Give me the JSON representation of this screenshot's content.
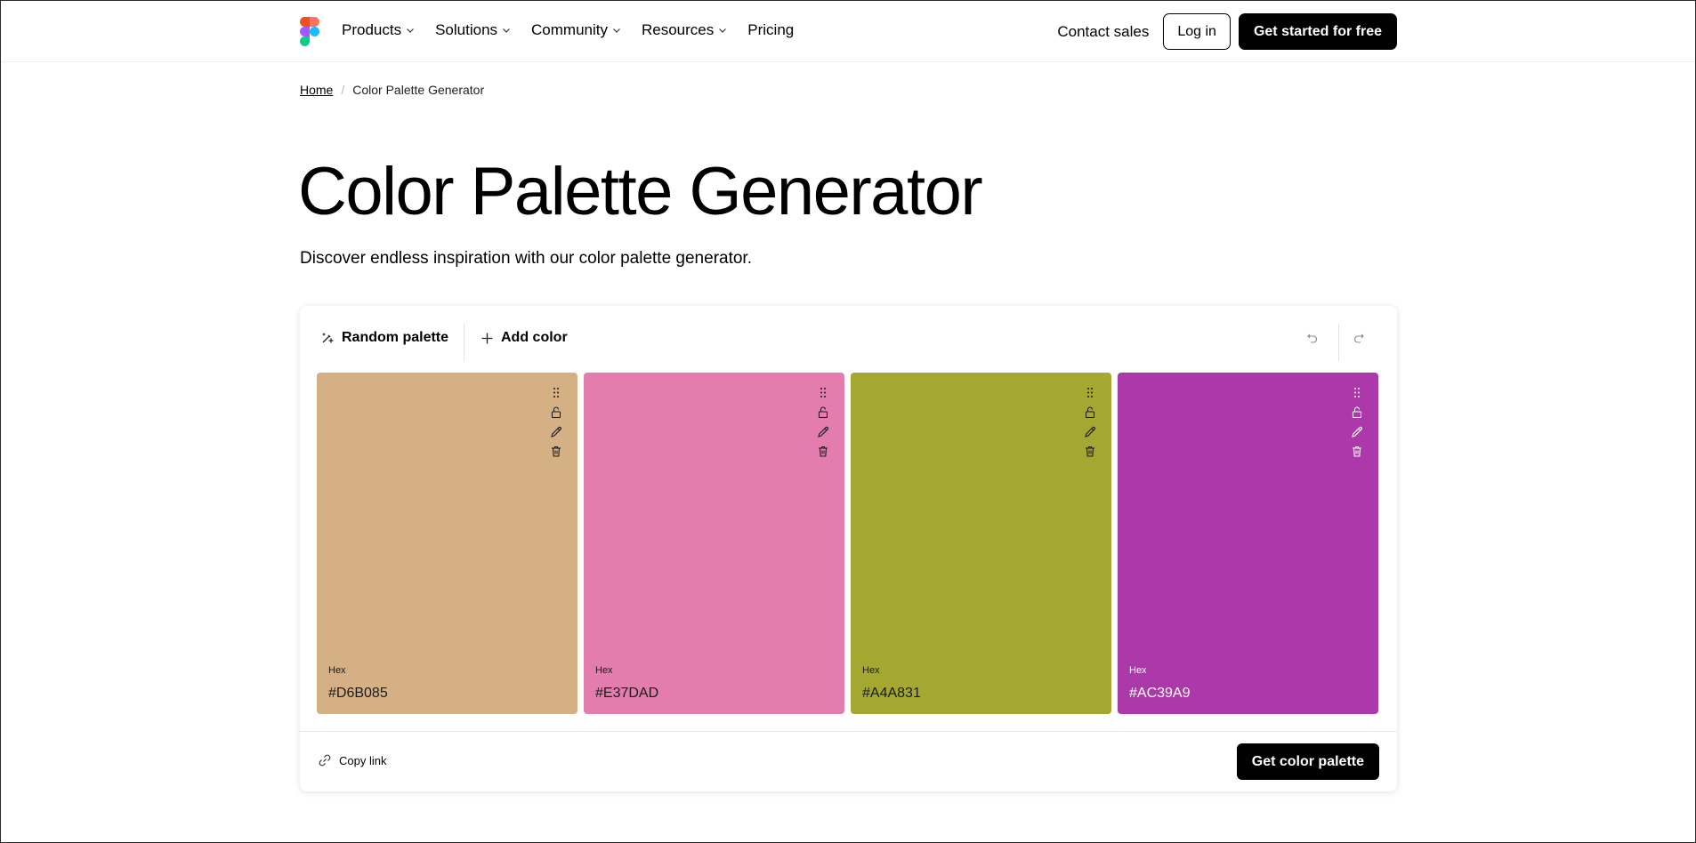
{
  "nav": {
    "items": [
      {
        "label": "Products",
        "has_dropdown": true
      },
      {
        "label": "Solutions",
        "has_dropdown": true
      },
      {
        "label": "Community",
        "has_dropdown": true
      },
      {
        "label": "Resources",
        "has_dropdown": true
      },
      {
        "label": "Pricing",
        "has_dropdown": false
      }
    ],
    "contact_label": "Contact sales",
    "login_label": "Log in",
    "start_label": "Get started for free",
    "logo_icon": "figma-logo-icon"
  },
  "breadcrumb": {
    "home": "Home",
    "current": "Color Palette Generator"
  },
  "hero": {
    "title": "Color Palette Generator",
    "subtitle": "Discover endless inspiration with our color palette generator."
  },
  "toolbar": {
    "random_label": "Random palette",
    "add_label": "Add color",
    "random_icon": "shuffle-sparkle-icon",
    "add_icon": "plus-icon",
    "undo_icon": "undo-icon",
    "redo_icon": "redo-icon"
  },
  "palette": {
    "hex_label": "Hex",
    "colors": [
      {
        "hex": "#D6B085",
        "text_color": "#1a1a1a"
      },
      {
        "hex": "#E37DAD",
        "text_color": "#1a1a1a"
      },
      {
        "hex": "#A4A831",
        "text_color": "#1a1a1a"
      },
      {
        "hex": "#AC39A9",
        "text_color": "#ffffff"
      }
    ]
  },
  "footer": {
    "copy_label": "Copy link",
    "copy_icon": "link-icon",
    "cta_label": "Get color palette"
  }
}
